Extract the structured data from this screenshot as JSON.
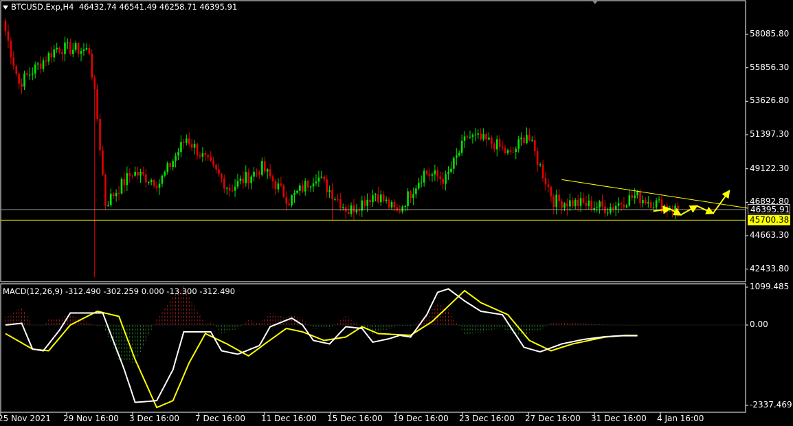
{
  "header": {
    "symbol": "BTCUSD.Exp,H4",
    "ohlc": "46432.74 46541.49 46258.71 46395.91"
  },
  "macd": {
    "label": "MACD(12,26,9) -312.490 -302.259 0.000 -13.300 -312.490"
  },
  "colors": {
    "bull": "#00e600",
    "bear": "#e60000",
    "macd_main": "#ffffff",
    "macd_signal": "#ffff00",
    "hist_pos": "#b22222",
    "hist_neg": "#228b22",
    "trendline": "#ffff00",
    "current_price": "#c0c0c0",
    "support_tag": "#ffff00"
  },
  "chart_data": [
    {
      "type": "candlestick",
      "price_ticks": [
        "58085.80",
        "55856.30",
        "53626.80",
        "51397.30",
        "49122.30",
        "46892.80",
        "44663.30",
        "42433.80"
      ],
      "price_tick_values": [
        58085.8,
        55856.3,
        53626.8,
        51397.3,
        49122.3,
        46892.8,
        44663.3,
        42433.8
      ],
      "current_price": "46395.91",
      "current_price_value": 46395.91,
      "support_level": "45700.38",
      "support_level_value": 45700.38,
      "x_ticks": [
        "25 Nov 2021",
        "29 Nov 16:00",
        "3 Dec 16:00",
        "7 Dec 16:00",
        "11 Dec 16:00",
        "15 Dec 16:00",
        "19 Dec 16:00",
        "23 Dec 16:00",
        "27 Dec 16:00",
        "31 Dec 16:00",
        "4 Jan 16:00"
      ],
      "segments": [
        {
          "bars": 6,
          "from": 59000,
          "to": 54800
        },
        {
          "bars": 14,
          "from": 54800,
          "to": 57200
        },
        {
          "bars": 12,
          "from": 57200,
          "to": 57000
        },
        {
          "bars": 3,
          "from": 57000,
          "to": 52500
        },
        {
          "bars": 3,
          "from": 52500,
          "to": 46800
        },
        {
          "bars": 10,
          "from": 46800,
          "to": 48900
        },
        {
          "bars": 10,
          "from": 48900,
          "to": 48200
        },
        {
          "bars": 10,
          "from": 48200,
          "to": 51200
        },
        {
          "bars": 16,
          "from": 51200,
          "to": 47800
        },
        {
          "bars": 12,
          "from": 47800,
          "to": 49200
        },
        {
          "bars": 10,
          "from": 49200,
          "to": 47000
        },
        {
          "bars": 10,
          "from": 47000,
          "to": 48700
        },
        {
          "bars": 12,
          "from": 48700,
          "to": 46300
        },
        {
          "bars": 10,
          "from": 46300,
          "to": 47500
        },
        {
          "bars": 8,
          "from": 47500,
          "to": 46200
        },
        {
          "bars": 10,
          "from": 46200,
          "to": 48900
        },
        {
          "bars": 8,
          "from": 48900,
          "to": 48400
        },
        {
          "bars": 8,
          "from": 48400,
          "to": 51300
        },
        {
          "bars": 10,
          "from": 51300,
          "to": 50800
        },
        {
          "bars": 6,
          "from": 50800,
          "to": 50000
        },
        {
          "bars": 6,
          "from": 50000,
          "to": 51500
        },
        {
          "bars": 10,
          "from": 51500,
          "to": 47000
        },
        {
          "bars": 10,
          "from": 47000,
          "to": 46800
        },
        {
          "bars": 10,
          "from": 46800,
          "to": 46500
        },
        {
          "bars": 10,
          "from": 46500,
          "to": 47300
        },
        {
          "bars": 10,
          "from": 47300,
          "to": 46700
        },
        {
          "bars": 6,
          "from": 46700,
          "to": 46396
        }
      ],
      "spikes": [
        {
          "bar": 33,
          "low": 41900
        },
        {
          "bar": 121,
          "low": 45650
        },
        {
          "bar": 208,
          "low": 46000
        }
      ],
      "trendline": {
        "from_bar": 206,
        "from_price": 48400,
        "to_bar": 279,
        "to_price": 46380
      },
      "projection_path": [
        {
          "bar": 240,
          "price": 46300
        },
        {
          "bar": 246,
          "price": 46450
        },
        {
          "bar": 250,
          "price": 46050
        },
        {
          "bar": 256,
          "price": 46650
        },
        {
          "bar": 262,
          "price": 46150
        },
        {
          "bar": 268,
          "price": 47650
        }
      ]
    },
    {
      "type": "macd",
      "ticks": [
        "1099.485",
        "0.00",
        "-2337.469"
      ],
      "tick_values": [
        1099.485,
        0,
        -2337.469
      ],
      "main_points": [
        [
          0,
          0
        ],
        [
          6,
          50
        ],
        [
          10,
          -700
        ],
        [
          14,
          -750
        ],
        [
          20,
          -150
        ],
        [
          24,
          350
        ],
        [
          36,
          350
        ],
        [
          44,
          -1300
        ],
        [
          48,
          -2250
        ],
        [
          56,
          -2200
        ],
        [
          62,
          -1300
        ],
        [
          66,
          -200
        ],
        [
          76,
          -200
        ],
        [
          80,
          -750
        ],
        [
          86,
          -850
        ],
        [
          94,
          -600
        ],
        [
          98,
          -50
        ],
        [
          106,
          200
        ],
        [
          110,
          0
        ],
        [
          114,
          -450
        ],
        [
          120,
          -550
        ],
        [
          126,
          -50
        ],
        [
          132,
          -100
        ],
        [
          136,
          -500
        ],
        [
          142,
          -400
        ],
        [
          146,
          -300
        ],
        [
          150,
          -350
        ],
        [
          156,
          300
        ],
        [
          160,
          950
        ],
        [
          164,
          1050
        ],
        [
          170,
          700
        ],
        [
          176,
          400
        ],
        [
          184,
          300
        ],
        [
          192,
          -650
        ],
        [
          198,
          -780
        ],
        [
          206,
          -550
        ],
        [
          214,
          -420
        ],
        [
          222,
          -340
        ],
        [
          228,
          -312
        ],
        [
          234,
          -312
        ]
      ],
      "signal_points": [
        [
          0,
          -250
        ],
        [
          10,
          -700
        ],
        [
          16,
          -750
        ],
        [
          24,
          0
        ],
        [
          34,
          400
        ],
        [
          42,
          250
        ],
        [
          48,
          -1000
        ],
        [
          56,
          -2400
        ],
        [
          62,
          -2200
        ],
        [
          68,
          -1100
        ],
        [
          74,
          -250
        ],
        [
          82,
          -550
        ],
        [
          90,
          -900
        ],
        [
          96,
          -550
        ],
        [
          104,
          -100
        ],
        [
          110,
          -200
        ],
        [
          118,
          -450
        ],
        [
          126,
          -350
        ],
        [
          132,
          -50
        ],
        [
          138,
          -250
        ],
        [
          150,
          -300
        ],
        [
          158,
          100
        ],
        [
          164,
          550
        ],
        [
          170,
          1000
        ],
        [
          176,
          650
        ],
        [
          186,
          300
        ],
        [
          194,
          -450
        ],
        [
          202,
          -750
        ],
        [
          210,
          -550
        ],
        [
          222,
          -350
        ],
        [
          230,
          -300
        ],
        [
          234,
          -302
        ]
      ]
    }
  ]
}
